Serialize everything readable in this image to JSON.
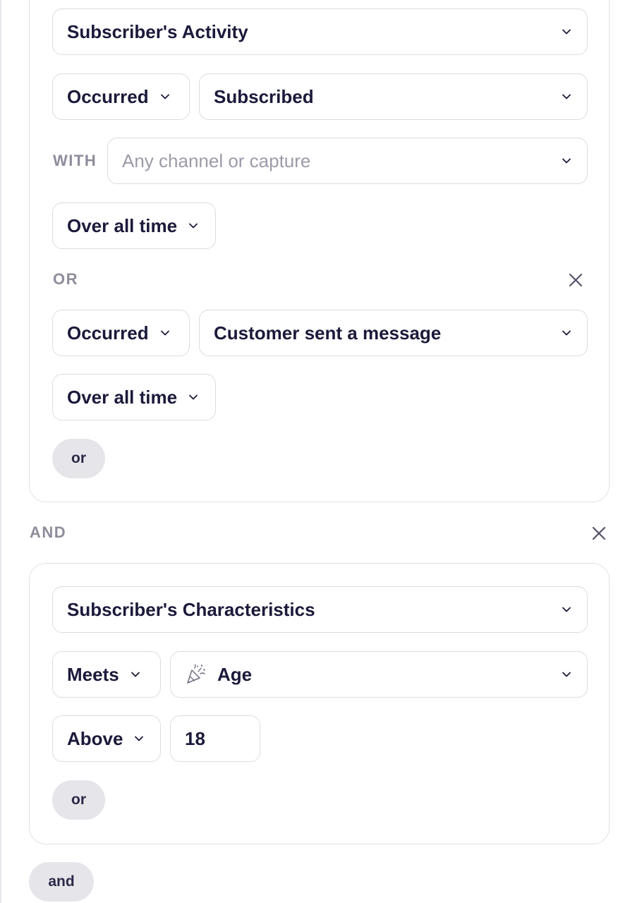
{
  "group1": {
    "category": "Subscriber's Activity",
    "condition1": {
      "operator": "Occurred",
      "event": "Subscribed",
      "with_label": "WITH",
      "with_placeholder": "Any channel or capture",
      "timeframe": "Over all time"
    },
    "or_label": "OR",
    "condition2": {
      "operator": "Occurred",
      "event": "Customer sent a message",
      "timeframe": "Over all time"
    },
    "or_button": "or"
  },
  "and_label": "AND",
  "group2": {
    "category": "Subscriber's Characteristics",
    "operator": "Meets",
    "property_icon": "party-popper-icon",
    "property": "Age",
    "comparison": "Above",
    "value": "18",
    "or_button": "or"
  },
  "and_button": "and"
}
